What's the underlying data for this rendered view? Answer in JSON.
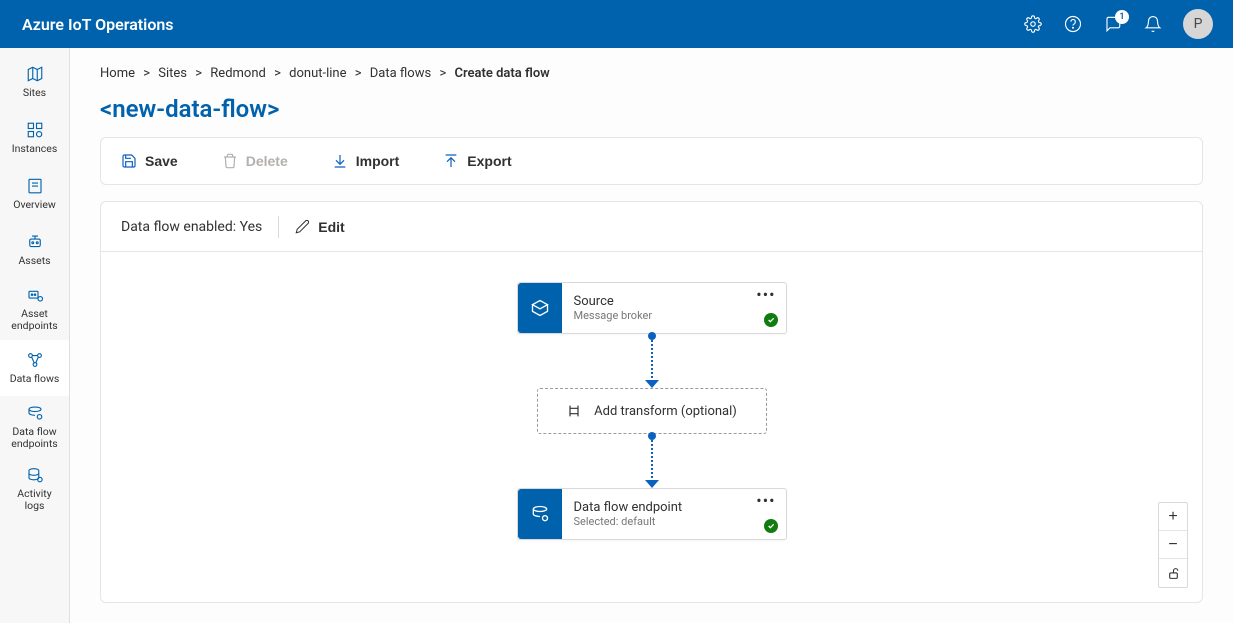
{
  "app_title": "Azure IoT Operations",
  "header": {
    "notification_badge": "1",
    "avatar_initial": "P"
  },
  "sidebar": [
    {
      "label": "Sites"
    },
    {
      "label": "Instances"
    },
    {
      "label": "Overview"
    },
    {
      "label": "Assets"
    },
    {
      "label": "Asset\nendpoints"
    },
    {
      "label": "Data flows"
    },
    {
      "label": "Data flow\nendpoints"
    },
    {
      "label": "Activity\nlogs"
    }
  ],
  "breadcrumbs": {
    "items": [
      "Home",
      "Sites",
      "Redmond",
      "donut-line",
      "Data flows"
    ],
    "current": "Create data flow",
    "sep": ">"
  },
  "page_title": "<new-data-flow>",
  "toolbar": {
    "save": "Save",
    "delete": "Delete",
    "import": "Import",
    "export": "Export"
  },
  "canvas": {
    "enabled_label": "Data flow enabled: Yes",
    "edit_label": "Edit",
    "source": {
      "title": "Source",
      "subtitle": "Message broker"
    },
    "transform": {
      "label": "Add transform (optional)"
    },
    "endpoint": {
      "title": "Data flow endpoint",
      "subtitle": "Selected: default"
    }
  }
}
